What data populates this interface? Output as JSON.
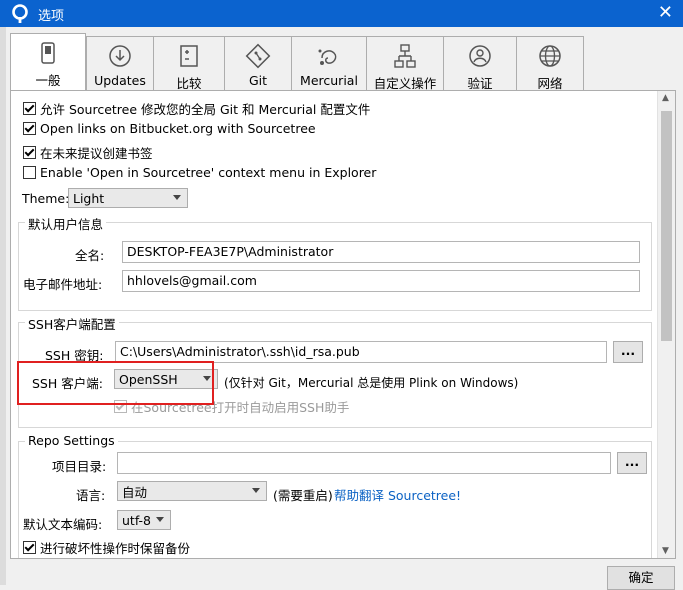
{
  "window": {
    "title": "选项"
  },
  "tabs": [
    {
      "label": "一般",
      "icon": "toggle-icon"
    },
    {
      "label": "Updates",
      "icon": "download-icon"
    },
    {
      "label": "比较",
      "icon": "diff-icon"
    },
    {
      "label": "Git",
      "icon": "git-icon"
    },
    {
      "label": "Mercurial",
      "icon": "mercurial-icon"
    },
    {
      "label": "自定义操作",
      "icon": "custom-actions-icon"
    },
    {
      "label": "验证",
      "icon": "user-icon"
    },
    {
      "label": "网络",
      "icon": "globe-icon"
    }
  ],
  "general": {
    "allow_modify_config": "允许 Sourcetree 修改您的全局 Git 和 Mercurial 配置文件",
    "open_links": "Open links on Bitbucket.org with Sourcetree",
    "suggest_bookmarks": "在未来提议创建书签",
    "context_menu": "Enable 'Open in Sourcetree' context menu in Explorer",
    "theme_label": "Theme:",
    "theme_value": "Light"
  },
  "user_info": {
    "title": "默认用户信息",
    "fullname_label": "全名:",
    "fullname_value": "DESKTOP-FEA3E7P\\Administrator",
    "email_label": "电子邮件地址:",
    "email_value": "hhlovels@gmail.com"
  },
  "ssh": {
    "title": "SSH客户端配置",
    "key_label": "SSH 密钥:",
    "key_value": "C:\\Users\\Administrator\\.ssh\\id_rsa.pub",
    "browse": "...",
    "client_label": "SSH 客户端:",
    "client_value": "OpenSSH",
    "note": "(仅针对 Git，Mercurial 总是使用 Plink on Windows)",
    "auto_start": "在Sourcetree打开时自动启用SSH助手"
  },
  "repo": {
    "title": "Repo Settings",
    "project_dir_label": "项目目录:",
    "project_dir_value": "",
    "browse": "...",
    "language_label": "语言:",
    "language_value": "自动",
    "restart_note": "(需要重启)",
    "translate_link": "帮助翻译 Sourcetree!",
    "encoding_label": "默认文本编码:",
    "encoding_value": "utf-8",
    "backup": "进行破坏性操作时保留备份"
  },
  "footer": {
    "ok": "确定"
  },
  "colors": {
    "titlebar": "#0b63cf",
    "highlight": "#e02020",
    "link": "#0b62c4"
  }
}
